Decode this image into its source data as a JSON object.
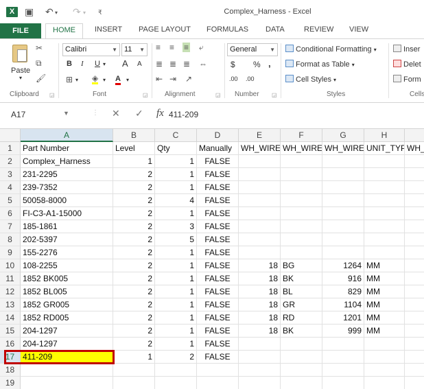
{
  "window": {
    "title": "Complex_Harness - Excel",
    "app_icon": "X",
    "undo_icon": "↶",
    "redo_icon": "↷",
    "save_icon": "💾"
  },
  "ribbon_tabs": [
    "FILE",
    "HOME",
    "INSERT",
    "PAGE LAYOUT",
    "FORMULAS",
    "DATA",
    "REVIEW",
    "VIEW"
  ],
  "ribbon": {
    "paste_label": "Paste",
    "font_name": "Calibri",
    "font_size": "11",
    "number_format": "General",
    "bold": "B",
    "italic": "I",
    "underline": "U",
    "grow_font": "A",
    "shrink_font": "A",
    "font_color": "A",
    "currency": "$",
    "percent": "%",
    "comma": ",",
    "inc_decimal": ".00",
    "dec_decimal": ".00",
    "conditional_formatting": "Conditional Formatting",
    "format_as_table": "Format as Table",
    "cell_styles": "Cell Styles",
    "insert": "Inser",
    "delete": "Delet",
    "format": "Form",
    "groups": {
      "clipboard": "Clipboard",
      "font": "Font",
      "alignment": "Alignment",
      "number": "Number",
      "styles": "Styles",
      "cells": "Cells"
    }
  },
  "formula_bar": {
    "name_box": "A17",
    "fx": "fx",
    "cancel": "✕",
    "enter": "✓",
    "value": "411-209"
  },
  "columns": [
    "A",
    "B",
    "C",
    "D",
    "E",
    "F",
    "G",
    "H"
  ],
  "row_numbers": [
    "1",
    "2",
    "3",
    "4",
    "5",
    "6",
    "7",
    "8",
    "9",
    "10",
    "11",
    "12",
    "13",
    "14",
    "15",
    "16",
    "17",
    "18",
    "19"
  ],
  "headers": [
    "Part Number",
    "Level",
    "Qty",
    "Manually",
    "WH_WIRE",
    "WH_WIRE",
    "WH_WIRE",
    "UNIT_TYPI",
    "WH_"
  ],
  "rows": [
    [
      "Complex_Harness",
      "1",
      "1",
      "FALSE",
      "",
      "",
      "",
      ""
    ],
    [
      "231-2295",
      "2",
      "1",
      "FALSE",
      "",
      "",
      "",
      ""
    ],
    [
      "239-7352",
      "2",
      "1",
      "FALSE",
      "",
      "",
      "",
      ""
    ],
    [
      "50058-8000",
      "2",
      "4",
      "FALSE",
      "",
      "",
      "",
      ""
    ],
    [
      "FI-C3-A1-15000",
      "2",
      "1",
      "FALSE",
      "",
      "",
      "",
      ""
    ],
    [
      "185-1861",
      "2",
      "3",
      "FALSE",
      "",
      "",
      "",
      ""
    ],
    [
      "202-5397",
      "2",
      "5",
      "FALSE",
      "",
      "",
      "",
      ""
    ],
    [
      "155-2276",
      "2",
      "1",
      "FALSE",
      "",
      "",
      "",
      ""
    ],
    [
      "108-2255",
      "2",
      "1",
      "FALSE",
      "18",
      "BG",
      "1264",
      "MM"
    ],
    [
      "1852 BK005",
      "2",
      "1",
      "FALSE",
      "18",
      "BK",
      "916",
      "MM"
    ],
    [
      "1852 BL005",
      "2",
      "1",
      "FALSE",
      "18",
      "BL",
      "829",
      "MM"
    ],
    [
      "1852 GR005",
      "2",
      "1",
      "FALSE",
      "18",
      "GR",
      "1104",
      "MM"
    ],
    [
      "1852 RD005",
      "2",
      "1",
      "FALSE",
      "18",
      "RD",
      "1201",
      "MM"
    ],
    [
      "204-1297",
      "2",
      "1",
      "FALSE",
      "18",
      "BK",
      "999",
      "MM"
    ],
    [
      "204-1297",
      "2",
      "1",
      "FALSE",
      "",
      "",
      "",
      ""
    ],
    [
      "411-209",
      "1",
      "2",
      "FALSE",
      "",
      "",
      "",
      ""
    ],
    [
      "",
      "",
      "",
      "",
      "",
      "",
      "",
      ""
    ],
    [
      "",
      "",
      "",
      "",
      "",
      "",
      "",
      ""
    ]
  ],
  "colors": {
    "excel_green": "#217346",
    "selected_cell_fill": "#ffff00",
    "selection_outline": "#c00000"
  }
}
